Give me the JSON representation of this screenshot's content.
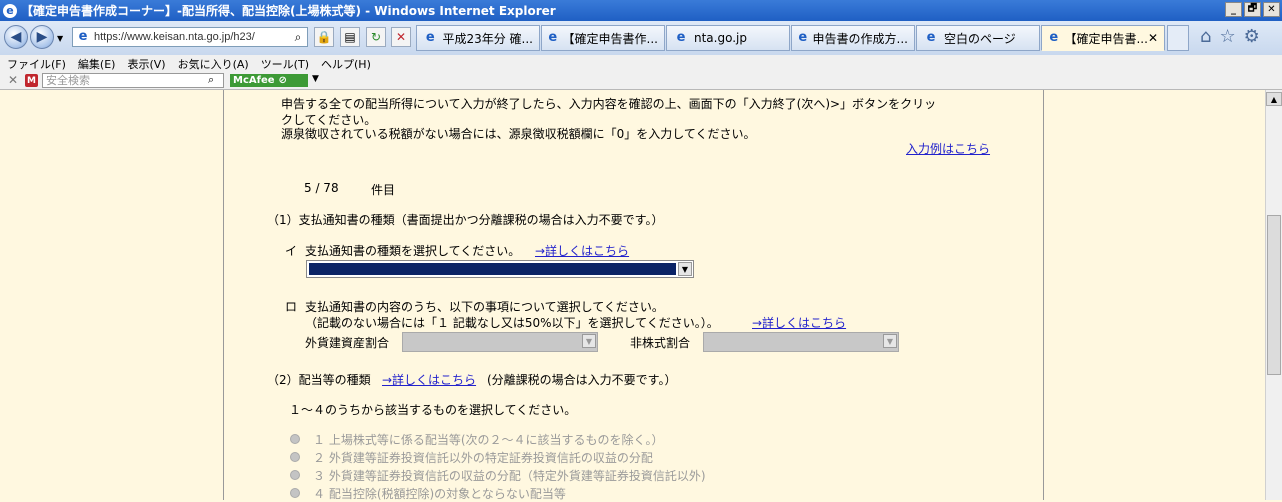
{
  "window": {
    "title": "【確定申告書作成コーナー】-配当所得、配当控除(上場株式等) - Windows Internet Explorer",
    "minimize": "_",
    "restore": "🗗",
    "close": "✕"
  },
  "nav": {
    "url": "https://www.keisan.nta.go.jp/h23/",
    "tabs": [
      {
        "label": "平成23年分 確..."
      },
      {
        "label": "【確定申告書作..."
      },
      {
        "label": "nta.go.jp"
      },
      {
        "label": "申告書の作成方..."
      },
      {
        "label": "空白のページ"
      },
      {
        "label": "【確定申告書...",
        "close": "✕"
      }
    ]
  },
  "menu": {
    "items": [
      "ファイル(F)",
      "編集(E)",
      "表示(V)",
      "お気に入り(A)",
      "ツール(T)",
      "ヘルプ(H)"
    ]
  },
  "command": {
    "search_placeholder": "安全検索",
    "mcafee": "McAfee"
  },
  "content": {
    "intro_line1": "申告する全ての配当所得について入力が終了したら、入力内容を確認の上、画面下の「入力終了(次へ)>」ボタンをクリッ",
    "intro_line2": "クしてください。",
    "intro_line3": "源泉徴収されている税額がない場合には、源泉徴収税額欄に「0」を入力してください。",
    "example_link": "入力例はこちら",
    "counter": "5 / 78",
    "counter_unit": "件目",
    "section1_title": "（1）支払通知書の種類（書面提出かつ分離課税の場合は入力不要です。）",
    "item_i_marker": "イ",
    "item_i_text": "支払通知書の種類を選択してください。",
    "detail_link": "→詳しくはこちら",
    "item_ro_marker": "ロ",
    "item_ro_line1": "支払通知書の内容のうち、以下の事項について選択してください。",
    "item_ro_line2": "（記載のない場合には「１ 記載なし又は50%以下」を選択してください。）。",
    "foreign_label": "外貨建資産割合",
    "nonstock_label": "非株式割合",
    "section2_title": "（2）配当等の種類",
    "section2_suffix": "(分離課税の場合は入力不要です。）",
    "instruction": "１～４のうちから該当するものを選択してください。",
    "options": [
      "１ 上場株式等に係る配当等(次の２～４に該当するものを除く。）",
      "２ 外貨建等証券投資信託以外の特定証券投資信託の収益の分配",
      "３ 外貨建等証券投資信託の収益の分配（特定外貨建等証券投資信託以外)",
      "４ 配当控除(税額控除)の対象とならない配当等"
    ]
  }
}
